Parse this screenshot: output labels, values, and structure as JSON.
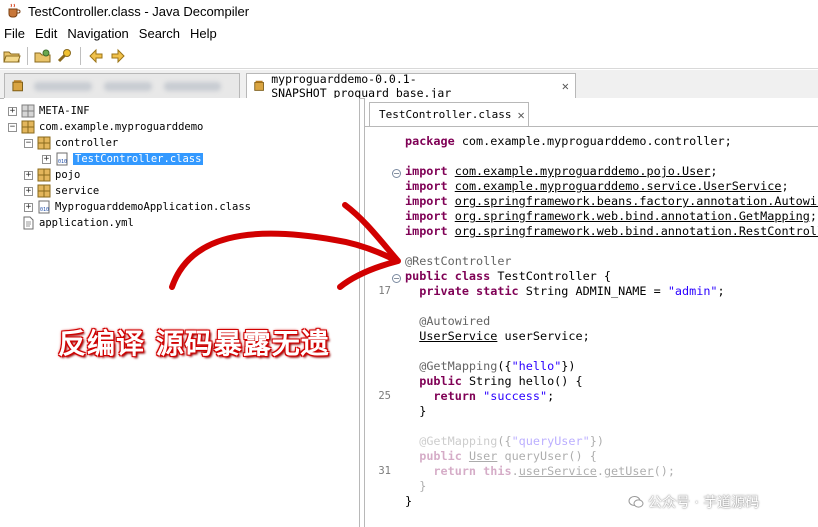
{
  "window": {
    "title": "TestController.class - Java Decompiler"
  },
  "menubar": {
    "items": [
      "File",
      "Edit",
      "Navigation",
      "Search",
      "Help"
    ]
  },
  "tabs": {
    "active_jar": "myproguarddemo-0.0.1-SNAPSHOT_proguard_base.jar",
    "close_glyph": "✕"
  },
  "tree": {
    "meta_inf": "META-INF",
    "package": "com.example.myproguarddemo",
    "controller": "controller",
    "test_controller": "TestController.class",
    "pojo": "pojo",
    "service": "service",
    "app_class": "MyproguarddemoApplication.class",
    "yml": "application.yml"
  },
  "source_tab": {
    "label": "TestController.class"
  },
  "code": {
    "line_numbers": {
      "l17": "17",
      "l25": "25",
      "l31": "31"
    },
    "package_kw": "package",
    "package_name": "com.example.myproguarddemo.controller;",
    "import_kw": "import",
    "imports": [
      "com.example.myproguarddemo.pojo.User",
      "com.example.myproguarddemo.service.UserService",
      "org.springframework.beans.factory.annotation.Autowired",
      "org.springframework.web.bind.annotation.GetMapping",
      "org.springframework.web.bind.annotation.RestController"
    ],
    "semicolon": ";",
    "rest_controller": "@RestController",
    "class_decl_kw": "public class",
    "class_name": " TestController {",
    "field_kw": "private static",
    "field_rest": " String ADMIN_NAME = ",
    "field_value": "\"admin\"",
    "autowired": "@Autowired",
    "user_service_type": "UserService",
    "user_service_rest": " userService;",
    "get_mapping_hello_ann": "@GetMapping",
    "get_mapping_hello_arg_open": "({",
    "get_mapping_hello_value": "\"hello\"",
    "get_mapping_hello_arg_close": "})",
    "hello_kw": "public",
    "hello_rest": " String hello() {",
    "return_kw": "return",
    "return_value": "\"success\"",
    "close_brace": "}",
    "get_mapping_query_ann": "@GetMapping",
    "get_mapping_query_arg_open": "({",
    "get_mapping_query_value": "\"queryUser\"",
    "get_mapping_query_arg_close": "})",
    "query_kw": "public",
    "query_type": "User",
    "query_rest": " queryUser() {",
    "return2_kw": "return",
    "this_kw": "this",
    "return2_dot": ".",
    "return2_field": "userService",
    "return2_method": "getUser",
    "return2_tail": "();"
  },
  "overlay": {
    "caption": "反编译 源码暴露无遗"
  },
  "watermark": {
    "text": "公众号 · 芋道源码"
  },
  "colors": {
    "keyword": "#7f0055",
    "string": "#2a00ff",
    "annotation": "#646464",
    "selection": "#3399ff",
    "overlay_red": "#d10000"
  }
}
